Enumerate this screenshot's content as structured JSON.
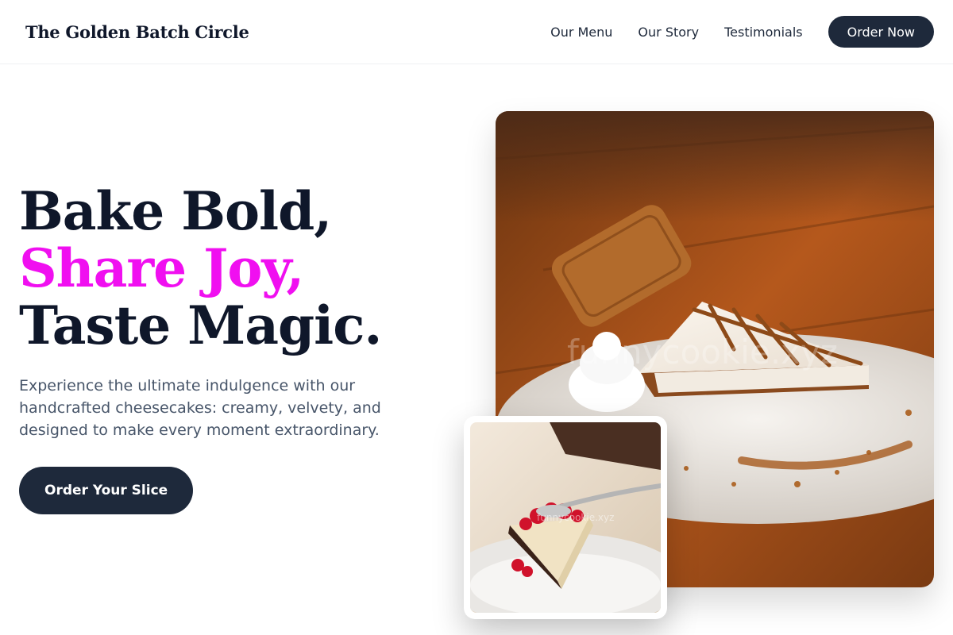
{
  "brand": "The Golden Batch Circle",
  "nav": {
    "links": [
      "Our Menu",
      "Our Story",
      "Testimonials"
    ],
    "cta": "Order Now"
  },
  "hero": {
    "line1": "Bake Bold,",
    "line2": "Share Joy,",
    "line3": "Taste Magic.",
    "description": "Experience the ultimate indulgence with our handcrafted cheesecakes: creamy, velvety, and designed to make every moment extraordinary.",
    "cta": "Order Your Slice"
  },
  "images": {
    "main_watermark": "funnycookie.xyz",
    "small_watermark": "funnycookie.xyz"
  },
  "colors": {
    "accent": "#f00ff0",
    "button": "#1e293b",
    "heading": "#0f172a"
  }
}
